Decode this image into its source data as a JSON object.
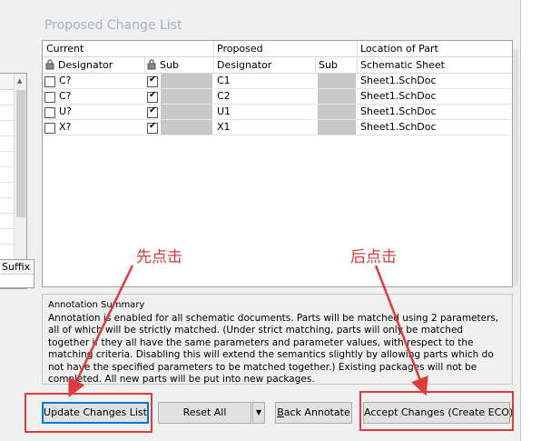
{
  "section_title": "Proposed Change List",
  "grid": {
    "group_headers": [
      "Current",
      "Proposed",
      "Location of Part"
    ],
    "columns": [
      "Designator",
      "Sub",
      "Designator",
      "Sub",
      "Schematic Sheet"
    ],
    "rows": [
      {
        "current": "C?",
        "proposed": "C1",
        "location": "Sheet1.SchDoc"
      },
      {
        "current": "C?",
        "proposed": "C2",
        "location": "Sheet1.SchDoc"
      },
      {
        "current": "U?",
        "proposed": "U1",
        "location": "Sheet1.SchDoc"
      },
      {
        "current": "X?",
        "proposed": "X1",
        "location": "Sheet1.SchDoc"
      }
    ]
  },
  "left_panel": {
    "suffix_header": "Suffix"
  },
  "summary": {
    "legend": "Annotation Summary",
    "text": "Annotation is enabled for all schematic documents. Parts will be matched using 2 parameters, all of which will be strictly matched. (Under strict matching, parts will only be matched together if they all have the same parameters and parameter values, with respect to the matching criteria. Disabling this will extend the semantics slightly by allowing parts which do not have the specified parameters to be matched together.) Existing packages will not be completed. All new parts will be put into new packages."
  },
  "buttons": {
    "update": "Update Changes List",
    "reset": "Reset All",
    "back_prefix": "B",
    "back_rest": "ack Annotate",
    "accept": "Accept Changes (Create ECO)"
  },
  "annotations": {
    "first_click": "先点击",
    "then_click": "后点击"
  },
  "colors": {
    "annotation_red": "#e03a3a",
    "title_blue": "#a6b4c8"
  }
}
